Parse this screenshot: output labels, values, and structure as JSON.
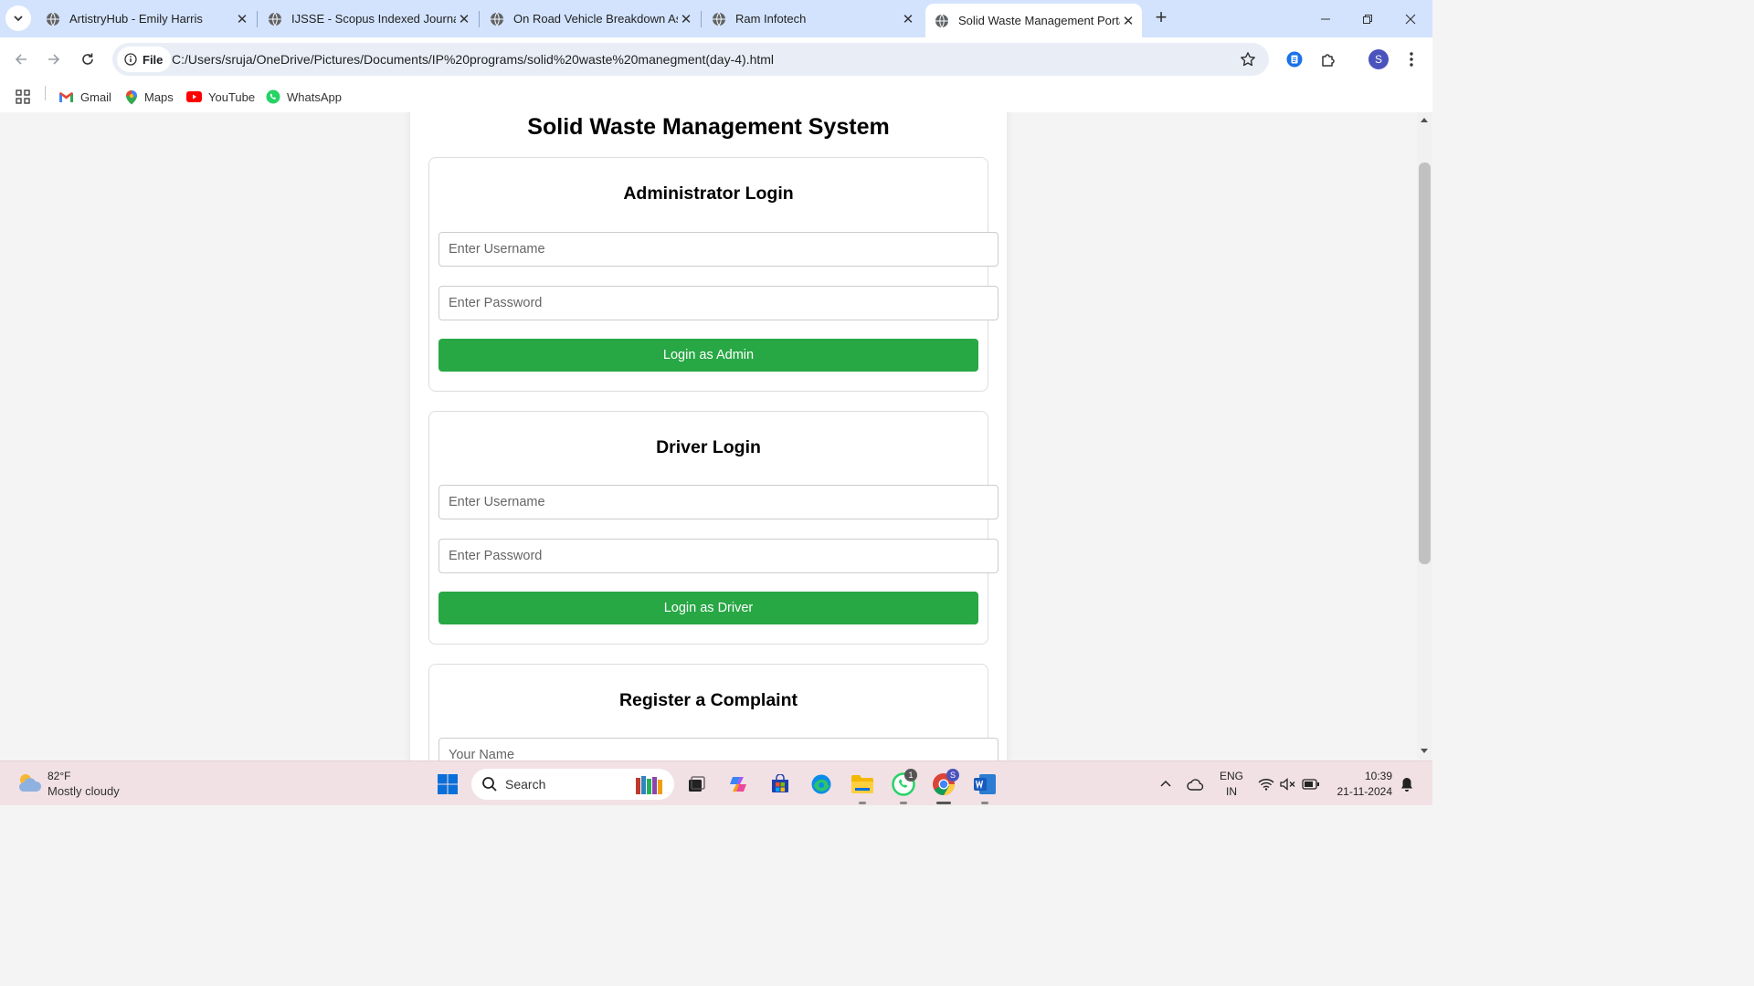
{
  "browser": {
    "tabs": [
      {
        "title": "ArtistryHub - Emily Harris",
        "active": false
      },
      {
        "title": "IJSSE - Scopus Indexed Journal",
        "active": false
      },
      {
        "title": "On Road Vehicle Breakdown Assistance",
        "active": false
      },
      {
        "title": "Ram Infotech",
        "active": false
      },
      {
        "title": "Solid Waste Management Portal",
        "active": true
      }
    ],
    "site_chip": "File",
    "url": "C:/Users/sruja/OneDrive/Pictures/Documents/IP%20programs/solid%20waste%20manegment(day-4).html",
    "profile_initial": "S",
    "bookmarks": [
      "Gmail",
      "Maps",
      "YouTube",
      "WhatsApp"
    ]
  },
  "page": {
    "title": "Solid Waste Management System",
    "admin": {
      "heading": "Administrator Login",
      "username_placeholder": "Enter Username",
      "password_placeholder": "Enter Password",
      "button": "Login as Admin"
    },
    "driver": {
      "heading": "Driver Login",
      "username_placeholder": "Enter Username",
      "password_placeholder": "Enter Password",
      "button": "Login as Driver"
    },
    "complaint": {
      "heading": "Register a Complaint",
      "name_placeholder": "Your Name"
    },
    "accent_color": "#28a745"
  },
  "taskbar": {
    "weather_temp": "82°F",
    "weather_desc": "Mostly cloudy",
    "search_label": "Search",
    "lang_line1": "ENG",
    "lang_line2": "IN",
    "time": "10:39",
    "date": "21-11-2024",
    "whatsapp_badge": "1",
    "chrome_badge": "S"
  }
}
